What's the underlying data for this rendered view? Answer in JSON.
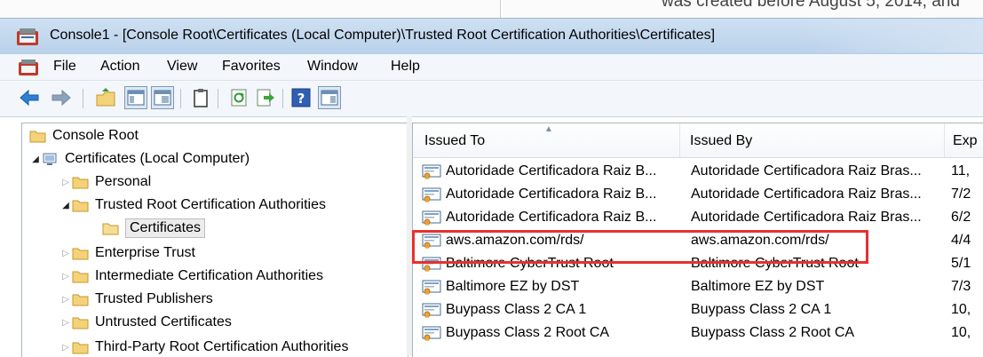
{
  "background_doc": {
    "text": "was created before August 5, 2014, and"
  },
  "window": {
    "title": "Console1 - [Console Root\\Certificates (Local Computer)\\Trusted Root Certification Authorities\\Certificates]"
  },
  "menu": [
    "File",
    "Action",
    "View",
    "Favorites",
    "Window",
    "Help"
  ],
  "toolbar": {
    "buttons": [
      "back-icon",
      "forward-icon",
      "up-folder-icon",
      "show-hide-console-tree-icon",
      "properties-icon",
      "refresh-icon",
      "export-list-icon",
      "help-icon",
      "show-hide-action-pane-icon"
    ]
  },
  "tree": {
    "nodes": [
      {
        "label": "Console Root",
        "expand": "none"
      },
      {
        "label": "Certificates (Local Computer)",
        "expand": "open"
      },
      {
        "label": "Personal",
        "expand": "closed"
      },
      {
        "label": "Trusted Root Certification Authorities",
        "expand": "open"
      },
      {
        "label": "Certificates",
        "expand": "none",
        "selected": true
      },
      {
        "label": "Enterprise Trust",
        "expand": "closed"
      },
      {
        "label": "Intermediate Certification Authorities",
        "expand": "closed"
      },
      {
        "label": "Trusted Publishers",
        "expand": "closed"
      },
      {
        "label": "Untrusted Certificates",
        "expand": "closed"
      },
      {
        "label": "Third-Party Root Certification Authorities",
        "expand": "closed"
      }
    ]
  },
  "list": {
    "columns": [
      "Issued To",
      "Issued By",
      "Exp"
    ],
    "rows": [
      {
        "issued_to": "Autoridade Certificadora Raiz B...",
        "issued_by": "Autoridade Certificadora Raiz Bras...",
        "exp": "11,"
      },
      {
        "issued_to": "Autoridade Certificadora Raiz B...",
        "issued_by": "Autoridade Certificadora Raiz Bras...",
        "exp": "7/2"
      },
      {
        "issued_to": "Autoridade Certificadora Raiz B...",
        "issued_by": "Autoridade Certificadora Raiz Bras...",
        "exp": "6/2"
      },
      {
        "issued_to": "aws.amazon.com/rds/",
        "issued_by": "aws.amazon.com/rds/",
        "exp": "4/4"
      },
      {
        "issued_to": "Baltimore CyberTrust Root",
        "issued_by": "Baltimore CyberTrust Root",
        "exp": "5/1"
      },
      {
        "issued_to": "Baltimore EZ by DST",
        "issued_by": "Baltimore EZ by DST",
        "exp": "7/3"
      },
      {
        "issued_to": "Buypass Class 2 CA 1",
        "issued_by": "Buypass Class 2 CA 1",
        "exp": "10,"
      },
      {
        "issued_to": "Buypass Class 2 Root CA",
        "issued_by": "Buypass Class 2 Root CA",
        "exp": "10,"
      }
    ],
    "highlighted_row": "aws.amazon.com/rds/"
  },
  "colors": {
    "highlight": "#e4322f",
    "titlebar": "#c4d8ee",
    "folder": "#f3d27a"
  }
}
